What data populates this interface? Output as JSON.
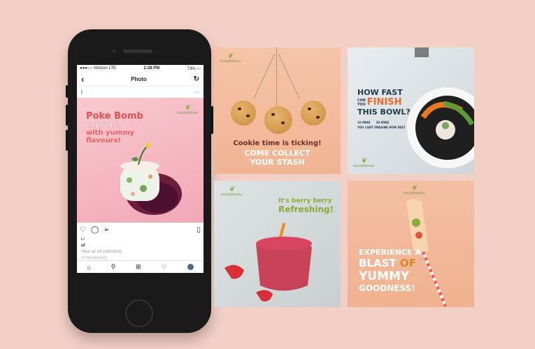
{
  "phone": {
    "status": {
      "carrier": "●●●○○ Verizon  LTE",
      "time": "2:28 PM",
      "battery": "73% ▭"
    },
    "nav": {
      "back": "‹",
      "title": "Photo",
      "refresh": "↻"
    },
    "user": {
      "name": "|",
      "more": "···"
    },
    "post": {
      "title": "Poke Bomb",
      "line2": "explodes",
      "line3": "with yummy",
      "line4": "flavours!",
      "brand": "SaladMania"
    },
    "likes": "Li",
    "caption_user": "ul",
    "comments": "View all 14 comments",
    "time_ago": "37 HOURS AGO",
    "tabs": [
      "home-icon",
      "search-icon",
      "add-icon",
      "heart-icon",
      "profile-icon"
    ]
  },
  "cards": {
    "cookie": {
      "brand": "SaladMania",
      "line1": "Cookie time is ticking!",
      "line2": "COME COLLECT",
      "line3": "YOUR STASH"
    },
    "bowl": {
      "line1": "HOW FAST",
      "can": "CAN",
      "you": "YOU",
      "finish": "FINISH",
      "line3": "THIS BOWL?",
      "opt1": "10 MINS",
      "opt2": "30 MINS",
      "opt3": "YOU CANT IMAGINE HOW FAST",
      "brand": "SaladMania"
    },
    "berry": {
      "brand": "SaladMania",
      "line1": "It's berry berry",
      "line2": "Refreshing!"
    },
    "blast": {
      "brand": "SaladMania",
      "line1": "EXPERIENCE A",
      "line2a": "BLAST",
      "line2b": "OF",
      "line3": "YUMMY",
      "line4": "GOODNESS!"
    }
  },
  "colors": {
    "bg": "#f2d0c6",
    "accent_red": "#e05252",
    "brand_green": "#8bab3a"
  }
}
